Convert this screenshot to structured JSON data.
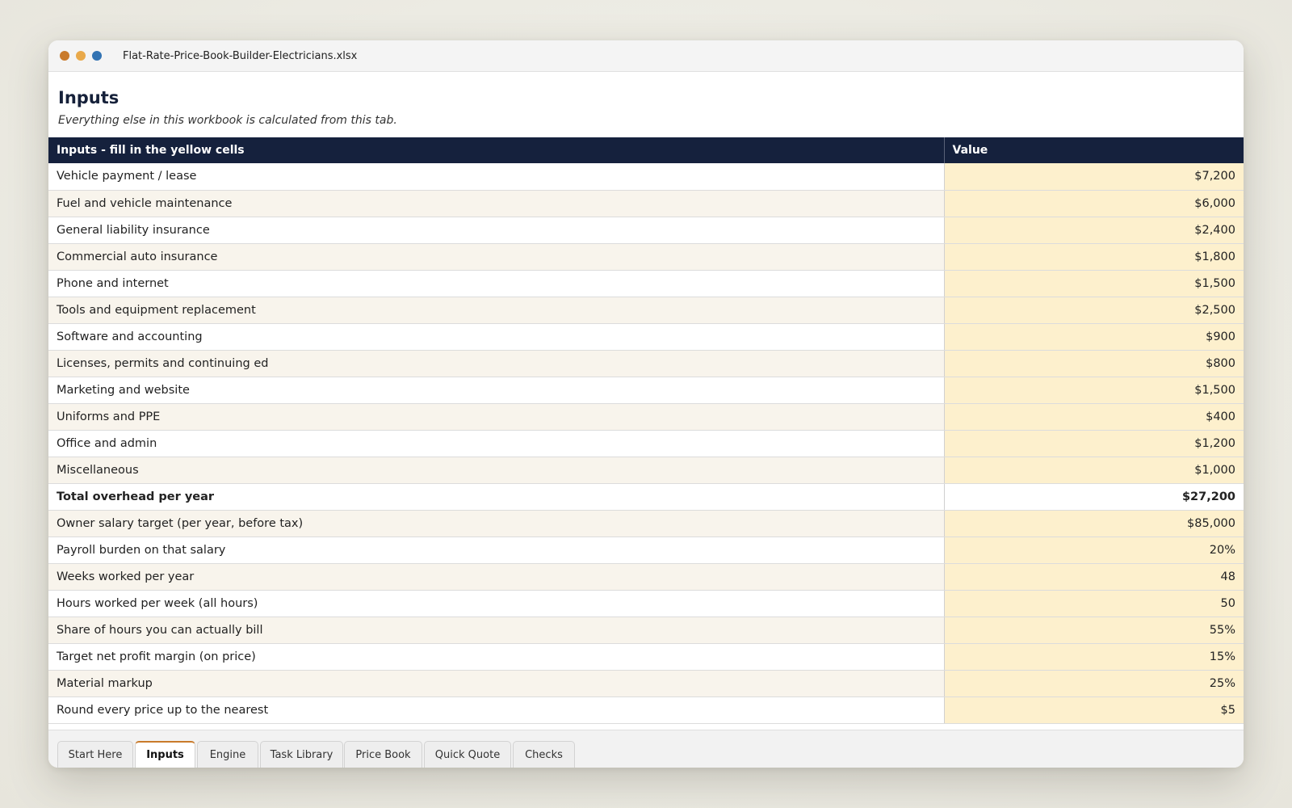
{
  "window": {
    "title": "Flat-Rate-Price-Book-Builder-Electricians.xlsx",
    "traffic_lights": [
      "#c97a2b",
      "#e9a94a",
      "#3273b3"
    ]
  },
  "sheet": {
    "title": "Inputs",
    "subtitle": "Everything else in this workbook is calculated from this tab."
  },
  "table": {
    "headers": [
      "Inputs - fill in the yellow cells",
      "Value"
    ],
    "rows": [
      {
        "label": "Vehicle payment / lease",
        "value": "$7,200"
      },
      {
        "label": "Fuel and vehicle maintenance",
        "value": "$6,000"
      },
      {
        "label": "General liability insurance",
        "value": "$2,400"
      },
      {
        "label": "Commercial auto insurance",
        "value": "$1,800"
      },
      {
        "label": "Phone and internet",
        "value": "$1,500"
      },
      {
        "label": "Tools and equipment replacement",
        "value": "$2,500"
      },
      {
        "label": "Software and accounting",
        "value": "$900"
      },
      {
        "label": "Licenses, permits and continuing ed",
        "value": "$800"
      },
      {
        "label": "Marketing and website",
        "value": "$1,500"
      },
      {
        "label": "Uniforms and PPE",
        "value": "$400"
      },
      {
        "label": "Office and admin",
        "value": "$1,200"
      },
      {
        "label": "Miscellaneous",
        "value": "$1,000"
      },
      {
        "label": "Total overhead per year",
        "value": "$27,200"
      },
      {
        "label": "Owner salary target (per year, before tax)",
        "value": "$85,000"
      },
      {
        "label": "Payroll burden on that salary",
        "value": "20%"
      },
      {
        "label": "Weeks worked per year",
        "value": "48"
      },
      {
        "label": "Hours worked per week (all hours)",
        "value": "50"
      },
      {
        "label": "Share of hours you can actually bill",
        "value": "55%"
      },
      {
        "label": "Target net profit margin (on price)",
        "value": "15%"
      },
      {
        "label": "Material markup",
        "value": "25%"
      },
      {
        "label": "Round every price up to the nearest",
        "value": "$5"
      }
    ]
  },
  "colors": {
    "header_bg": "#15213d",
    "input_cell": "#fdf0cd",
    "stripe": "#f8f4ec",
    "active_tab_accent": "#c97a2b"
  },
  "tabs": [
    {
      "label": "Start Here",
      "active": false
    },
    {
      "label": "Inputs",
      "active": true
    },
    {
      "label": "Engine",
      "active": false
    },
    {
      "label": "Task Library",
      "active": false
    },
    {
      "label": "Price Book",
      "active": false
    },
    {
      "label": "Quick Quote",
      "active": false
    },
    {
      "label": "Checks",
      "active": false
    }
  ]
}
